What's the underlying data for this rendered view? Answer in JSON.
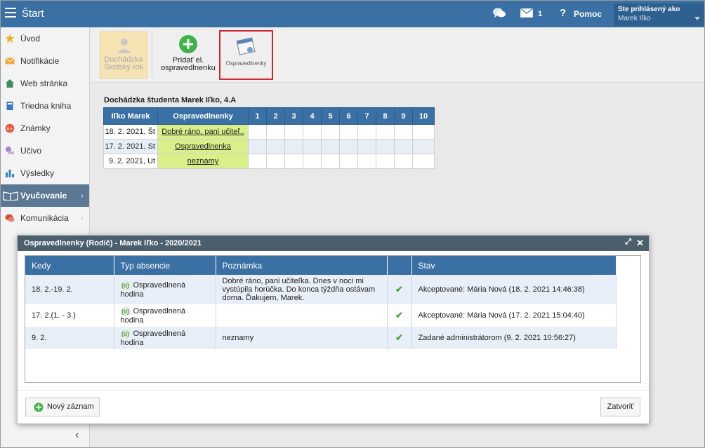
{
  "header": {
    "title": "Štart",
    "mail_count": "1",
    "help_icon": "?",
    "help_label": "Pomoc",
    "user_label": "Ste prihlásený ako",
    "user_name": "Marek Iľko"
  },
  "sidebar": {
    "items": [
      {
        "label": "Úvod",
        "icon": "star-icon"
      },
      {
        "label": "Notifikácie",
        "icon": "envelope-icon"
      },
      {
        "label": "Web stránka",
        "icon": "house-icon"
      },
      {
        "label": "Triedna kniha",
        "icon": "book-icon"
      },
      {
        "label": "Známky",
        "icon": "grade-icon"
      },
      {
        "label": "Učivo",
        "icon": "study-icon"
      },
      {
        "label": "Výsledky",
        "icon": "results-icon"
      },
      {
        "label": "Vyučovanie",
        "icon": "teaching-icon"
      },
      {
        "label": "Komunikácia",
        "icon": "chat-icon"
      }
    ],
    "collapse": "‹",
    "active": "Vyučovanie"
  },
  "toolbar": {
    "attendance_line1": "Dochádzka",
    "attendance_line2": "Školský rok",
    "add_line1": "Pridať el.",
    "add_line2": "ospravedlnenku",
    "excuses": "Ospravedlnenky"
  },
  "attendance": {
    "title": "Dochádzka študenta Marek Iľko, 4.A",
    "col_name": "Iľko Marek",
    "col_excuses": "Ospravedlnenky",
    "periods": [
      "1",
      "2",
      "3",
      "4",
      "5",
      "6",
      "7",
      "8",
      "9",
      "10"
    ],
    "rows": [
      {
        "date": "18. 2. 2021, Št",
        "excuse": "Dobré ráno, pani učiteľ.."
      },
      {
        "date": "17. 2. 2021, St",
        "excuse": "Ospravedlnenka"
      },
      {
        "date": "9. 2. 2021, Ut",
        "excuse": "neznamy"
      }
    ]
  },
  "dialog": {
    "title": "Ospravedlnenky (Rodič) - Marek Iľko - 2020/2021",
    "columns": {
      "when": "Kedy",
      "type": "Typ absencie",
      "note": "Poznámka",
      "state": "Stav"
    },
    "rows": [
      {
        "when": "18. 2.-19. 2.",
        "badge": "(o)",
        "type": "Ospravedlnená hodina",
        "note": "Dobré ráno, pani učiteľka. Dnes v noci mi vystúpila horúčka. Do konca týždňa ostávam doma. Ďakujem, Marek.",
        "check": "✔",
        "state": "Akceptované: Mária Nová (18. 2. 2021 14:46:38)"
      },
      {
        "when": "17. 2.(1. - 3.)",
        "badge": "(o)",
        "type": "Ospravedlnená hodina",
        "note": "",
        "check": "✔",
        "state": "Akceptované: Mária Nová (17. 2. 2021 15:04:40)"
      },
      {
        "when": "9. 2.",
        "badge": "(o)",
        "type": "Ospravedlnená hodina",
        "note": "neznamy",
        "check": "✔",
        "state": "Zadané administrátorom (9. 2. 2021 10:56:27)"
      }
    ],
    "new_button": "Nový záznam",
    "close_button": "Zatvoriť"
  },
  "colors": {
    "primary": "#3a70a3",
    "accent_green": "#d9f08a",
    "highlight_red": "#d42630"
  }
}
